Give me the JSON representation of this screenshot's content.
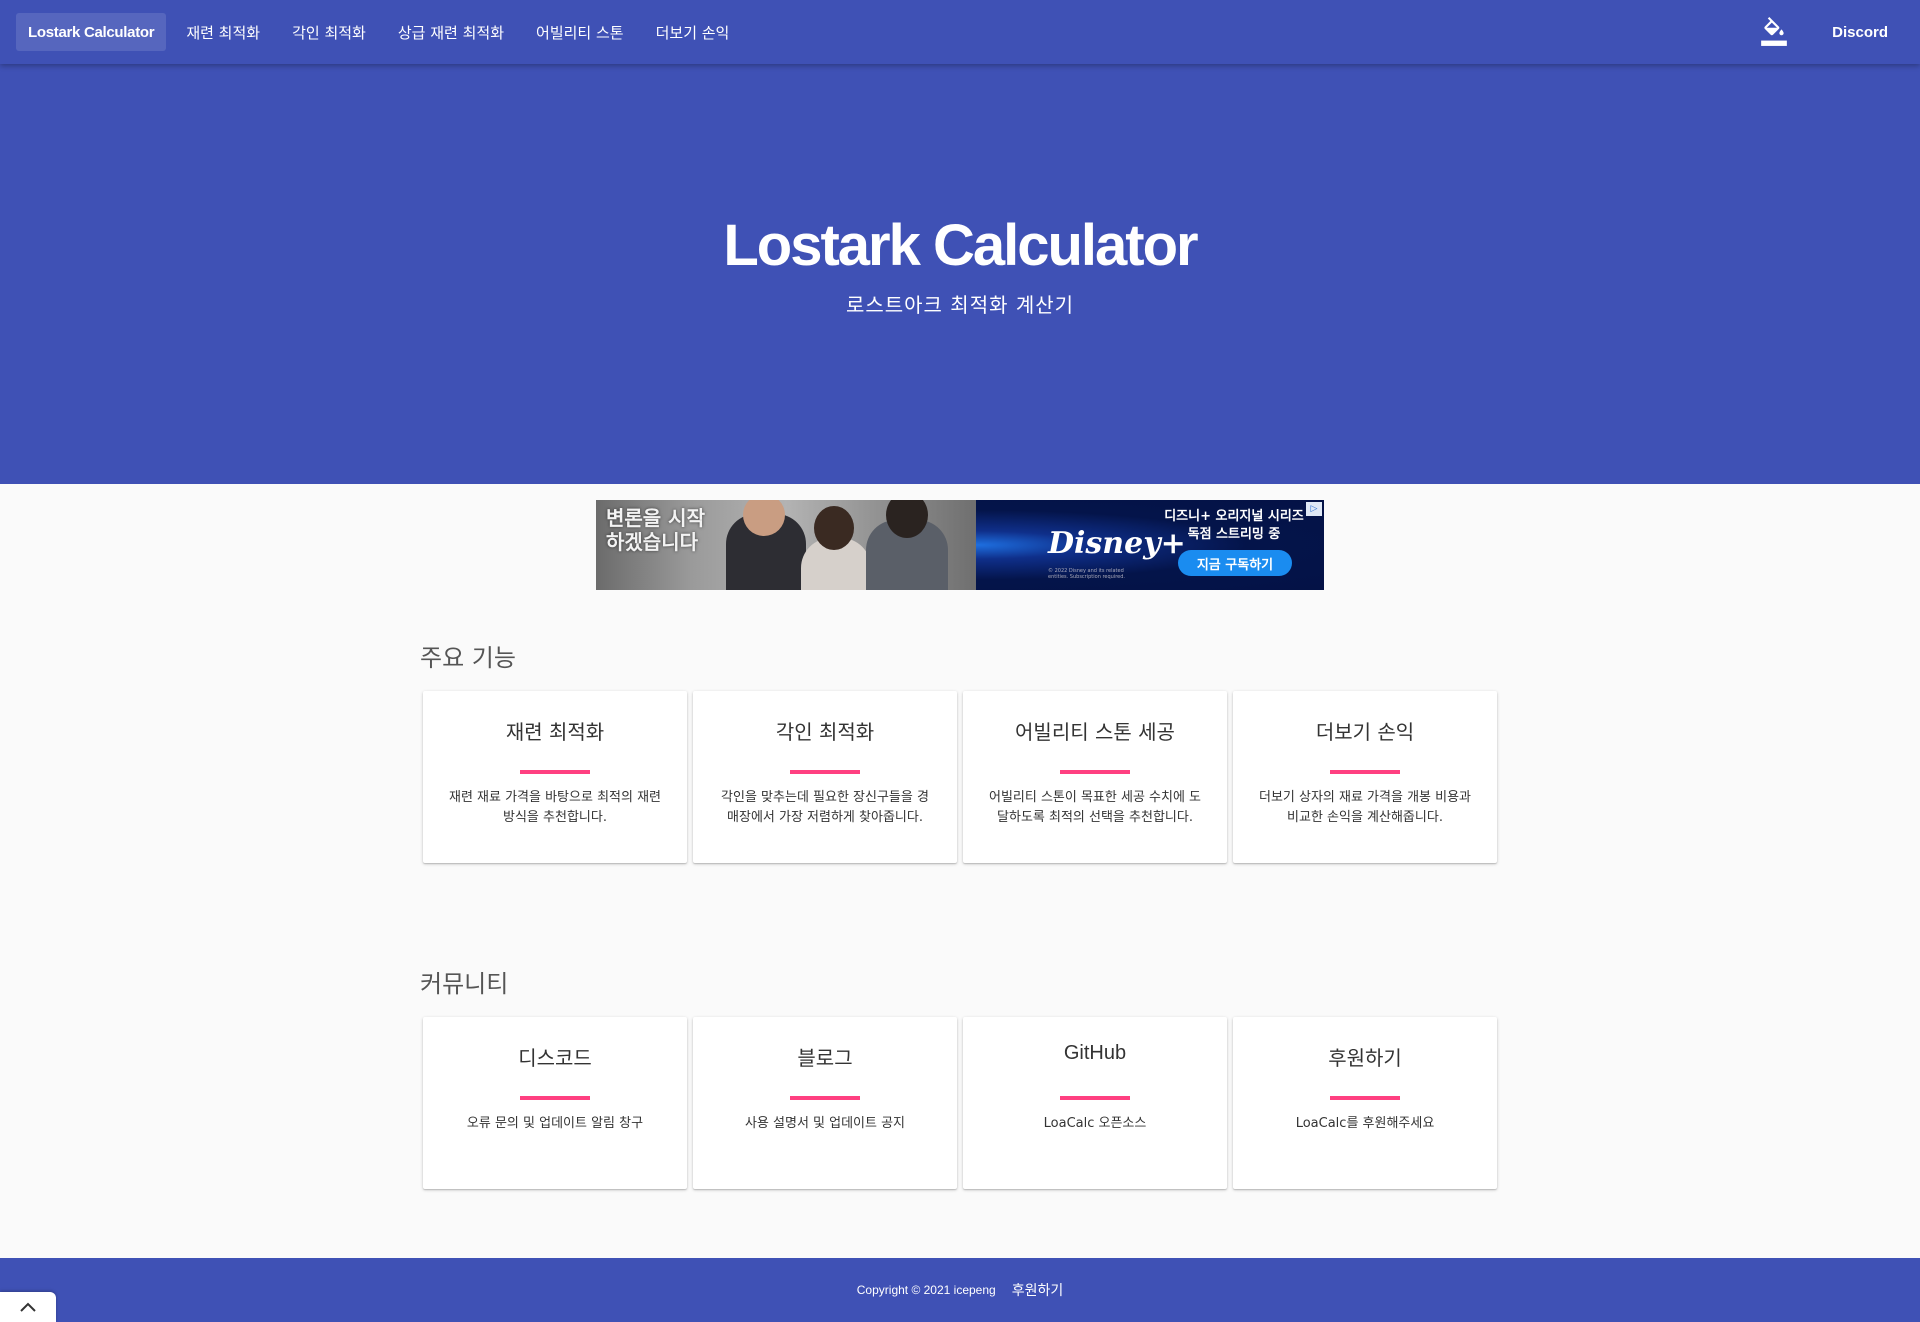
{
  "nav": {
    "brand": "Lostark Calculator",
    "items": [
      {
        "label": "재련 최적화"
      },
      {
        "label": "각인 최적화"
      },
      {
        "label": "상급 재련 최적화"
      },
      {
        "label": "어빌리티 스톤"
      },
      {
        "label": "더보기 손익"
      }
    ],
    "theme_icon": "format-color-fill-icon",
    "discord_label": "Discord"
  },
  "hero": {
    "title": "Lostark Calculator",
    "subtitle": "로스트아크 최적화 계산기"
  },
  "ad": {
    "poster_text": "변론을 시작 하겠습니다",
    "brand": "Disney+",
    "fine_print": "© 2022 Disney and its related entities. Subscription required.",
    "headline_line1": "디즈니+ 오리지널 시리즈",
    "headline_line2": "독점 스트리밍 중",
    "cta": "지금 구독하기"
  },
  "features": {
    "title": "주요 기능",
    "cards": [
      {
        "title": "재련 최적화",
        "desc": "재련 재료 가격을 바탕으로 최적의 재련 방식을 추천합니다."
      },
      {
        "title": "각인 최적화",
        "desc": "각인을 맞추는데 필요한 장신구들을 경매장에서 가장 저렴하게 찾아줍니다."
      },
      {
        "title": "어빌리티 스톤 세공",
        "desc": "어빌리티 스톤이 목표한 세공 수치에 도달하도록 최적의 선택을 추천합니다."
      },
      {
        "title": "더보기 손익",
        "desc": "더보기 상자의 재료 가격을 개봉 비용과 비교한 손익을 계산해줍니다."
      }
    ]
  },
  "community": {
    "title": "커뮤니티",
    "cards": [
      {
        "title": "디스코드",
        "desc": "오류 문의 및 업데이트 알림 창구"
      },
      {
        "title": "블로그",
        "desc": "사용 설명서 및 업데이트 공지"
      },
      {
        "title": "GitHub",
        "desc": "LoaCalc 오픈소스"
      },
      {
        "title": "후원하기",
        "desc": "LoaCalc를 후원해주세요"
      }
    ]
  },
  "footer": {
    "copyright": "Copyright © 2021 icepeng",
    "donate": "후원하기"
  },
  "colors": {
    "primary": "#3f51b5",
    "accent": "#ff4081",
    "background": "#fafafa"
  }
}
